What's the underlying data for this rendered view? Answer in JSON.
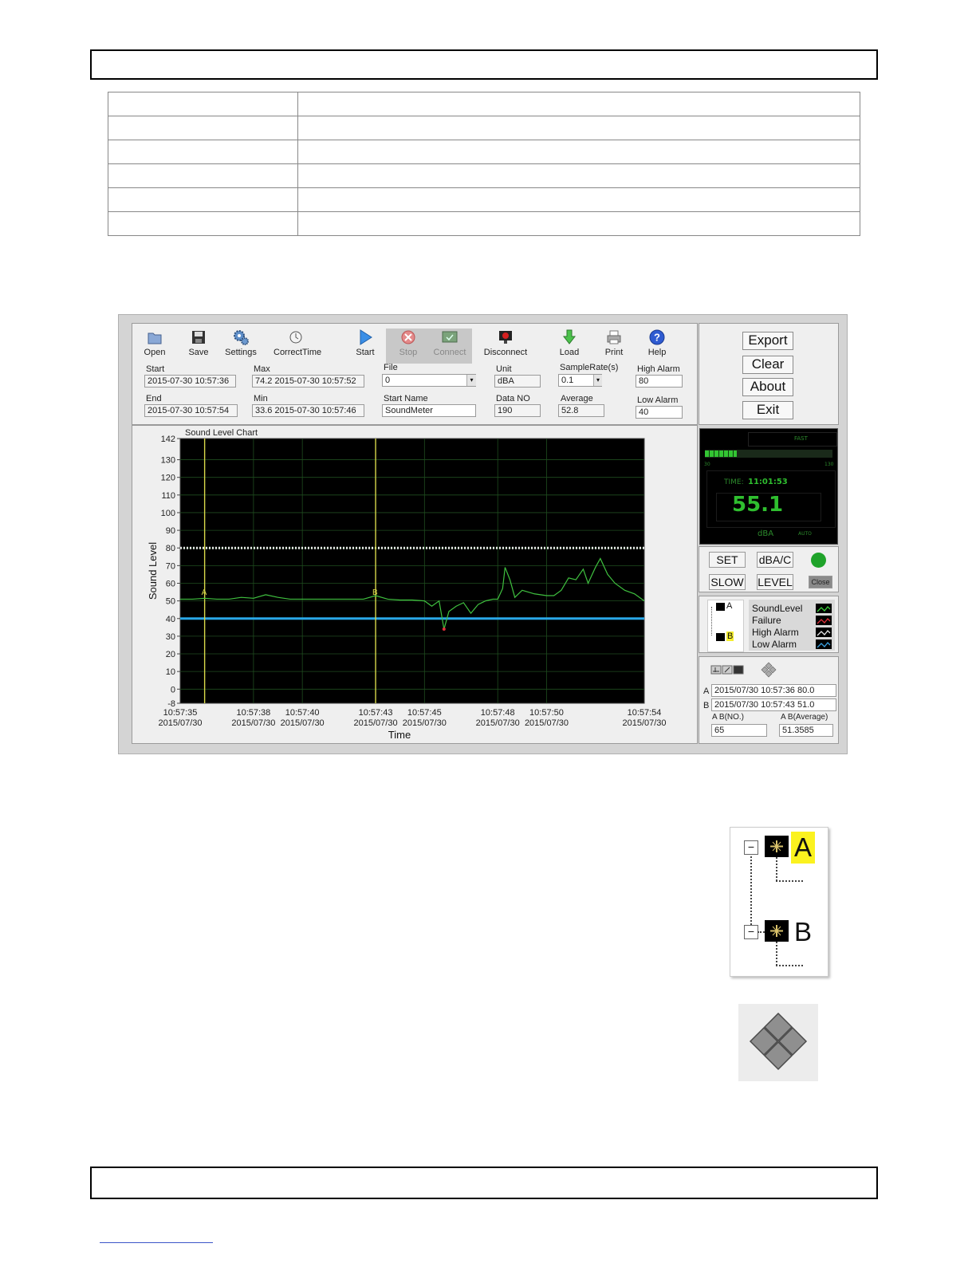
{
  "page": {
    "header_box": "",
    "footer_box": ""
  },
  "toolbar": {
    "buttons": [
      {
        "label": "Open",
        "icon": "folder-open-icon"
      },
      {
        "label": "Save",
        "icon": "floppy-disk-icon"
      },
      {
        "label": "Settings",
        "icon": "gears-icon"
      },
      {
        "label": "CorrectTime",
        "icon": "clock-icon"
      },
      {
        "label": "Start",
        "icon": "play-icon"
      },
      {
        "label": "Stop",
        "icon": "stop-icon"
      },
      {
        "label": "Connect",
        "icon": "connect-icon"
      },
      {
        "label": "Disconnect",
        "icon": "disconnect-icon"
      },
      {
        "label": "Load",
        "icon": "download-arrow-icon"
      },
      {
        "label": "Print",
        "icon": "printer-icon"
      },
      {
        "label": "Help",
        "icon": "help-icon"
      }
    ]
  },
  "info": {
    "start_label": "Start",
    "start_value": "2015-07-30 10:57:36",
    "end_label": "End",
    "end_value": "2015-07-30 10:57:54",
    "max_label": "Max",
    "max_value": "74.2 2015-07-30 10:57:52",
    "min_label": "Min",
    "min_value": "33.6 2015-07-30 10:57:46",
    "file_label": "File",
    "file_value": "0",
    "start_name_label": "Start Name",
    "start_name_value": "SoundMeter",
    "unit_label": "Unit",
    "unit_value": "dBA",
    "data_no_label": "Data NO",
    "data_no_value": "190",
    "sample_rate_label": "SampleRate(s)",
    "sample_rate_value": "0.1",
    "average_label": "Average",
    "average_value": "52.8",
    "high_alarm_label": "High Alarm",
    "high_alarm_value": "80",
    "low_alarm_label": "Low Alarm",
    "low_alarm_value": "40"
  },
  "side_buttons": {
    "export": "Export",
    "clear": "Clear",
    "about": "About",
    "exit": "Exit"
  },
  "meter": {
    "mode": "FAST",
    "scale_min": "30",
    "scale_max": "130",
    "time_label": "TIME:",
    "time_value": "11:01:53",
    "reading": "55.1",
    "unit": "dBA",
    "auto": "AUTO"
  },
  "meter_buttons": {
    "set": "SET",
    "dba_c": "dBA/C",
    "slow": "SLOW",
    "level": "LEVEL",
    "close": "Close"
  },
  "status_color": "#1fa32a",
  "cursor_tree": {
    "a": "A",
    "b": "B"
  },
  "legend": [
    "SoundLevel",
    "Failure",
    "High Alarm",
    "Low Alarm"
  ],
  "cursor_info": {
    "a_label": "A",
    "a_value": "2015/07/30 10:57:36 80.0",
    "b_label": "B",
    "b_value": "2015/07/30 10:57:43 51.0",
    "ab_no_label": "A B(NO.)",
    "ab_no_value": "65",
    "ab_avg_label": "A B(Average)",
    "ab_avg_value": "51.3585"
  },
  "chart_data": {
    "type": "line",
    "title": "Sound Level Chart",
    "xlabel": "Time",
    "ylabel": "Sound Level",
    "ylim": [
      -8,
      142
    ],
    "yticks": [
      -8,
      0,
      10,
      20,
      30,
      40,
      50,
      60,
      70,
      80,
      90,
      100,
      110,
      120,
      130,
      142
    ],
    "xticks": [
      {
        "time": "10:57:35",
        "date": "2015/07/30",
        "t": 35
      },
      {
        "time": "10:57:38",
        "date": "2015/07/30",
        "t": 38
      },
      {
        "time": "10:57:40",
        "date": "2015/07/30",
        "t": 40
      },
      {
        "time": "10:57:43",
        "date": "2015/07/30",
        "t": 43
      },
      {
        "time": "10:57:45",
        "date": "2015/07/30",
        "t": 45
      },
      {
        "time": "10:57:48",
        "date": "2015/07/30",
        "t": 48
      },
      {
        "time": "10:57:50",
        "date": "2015/07/30",
        "t": 50
      },
      {
        "time": "10:57:54",
        "date": "2015/07/30",
        "t": 54
      }
    ],
    "xlim": [
      35,
      54
    ],
    "high_alarm": 80,
    "low_alarm": 40,
    "cursors": [
      {
        "name": "A",
        "t": 36
      },
      {
        "name": "B",
        "t": 43
      }
    ],
    "series": [
      {
        "name": "SoundLevel",
        "x": [
          35,
          35.5,
          36,
          36.5,
          37,
          37.5,
          38,
          38.5,
          39,
          39.5,
          40,
          41,
          42,
          42.5,
          43,
          43.5,
          44,
          44.5,
          45,
          45.3,
          45.6,
          45.8,
          46,
          46.3,
          46.6,
          46.9,
          47.2,
          47.5,
          47.8,
          48,
          48.2,
          48.3,
          48.5,
          48.7,
          49,
          49.5,
          50,
          50.3,
          50.6,
          50.9,
          51.2,
          51.5,
          51.7,
          52,
          52.2,
          52.5,
          52.8,
          53.2,
          53.6,
          54
        ],
        "values": [
          51,
          51,
          51.5,
          51,
          51,
          52,
          51.5,
          53.5,
          52,
          51,
          51,
          51,
          51,
          51,
          53,
          51,
          50.5,
          50.5,
          50,
          47,
          50,
          34,
          44,
          47,
          49,
          43,
          48,
          50,
          51,
          51,
          57,
          69,
          62,
          52,
          56,
          54,
          53,
          53,
          56,
          63,
          62,
          68,
          60,
          69,
          74,
          65,
          60,
          56,
          54,
          50
        ]
      }
    ],
    "failure": [
      {
        "t": 45.8,
        "value": 34
      }
    ]
  },
  "zoom_icons": {
    "zoom": "zoom-tools-icon",
    "pan": "pan-diamond-icon"
  },
  "enlarged": {
    "a": "A",
    "b": "B"
  }
}
